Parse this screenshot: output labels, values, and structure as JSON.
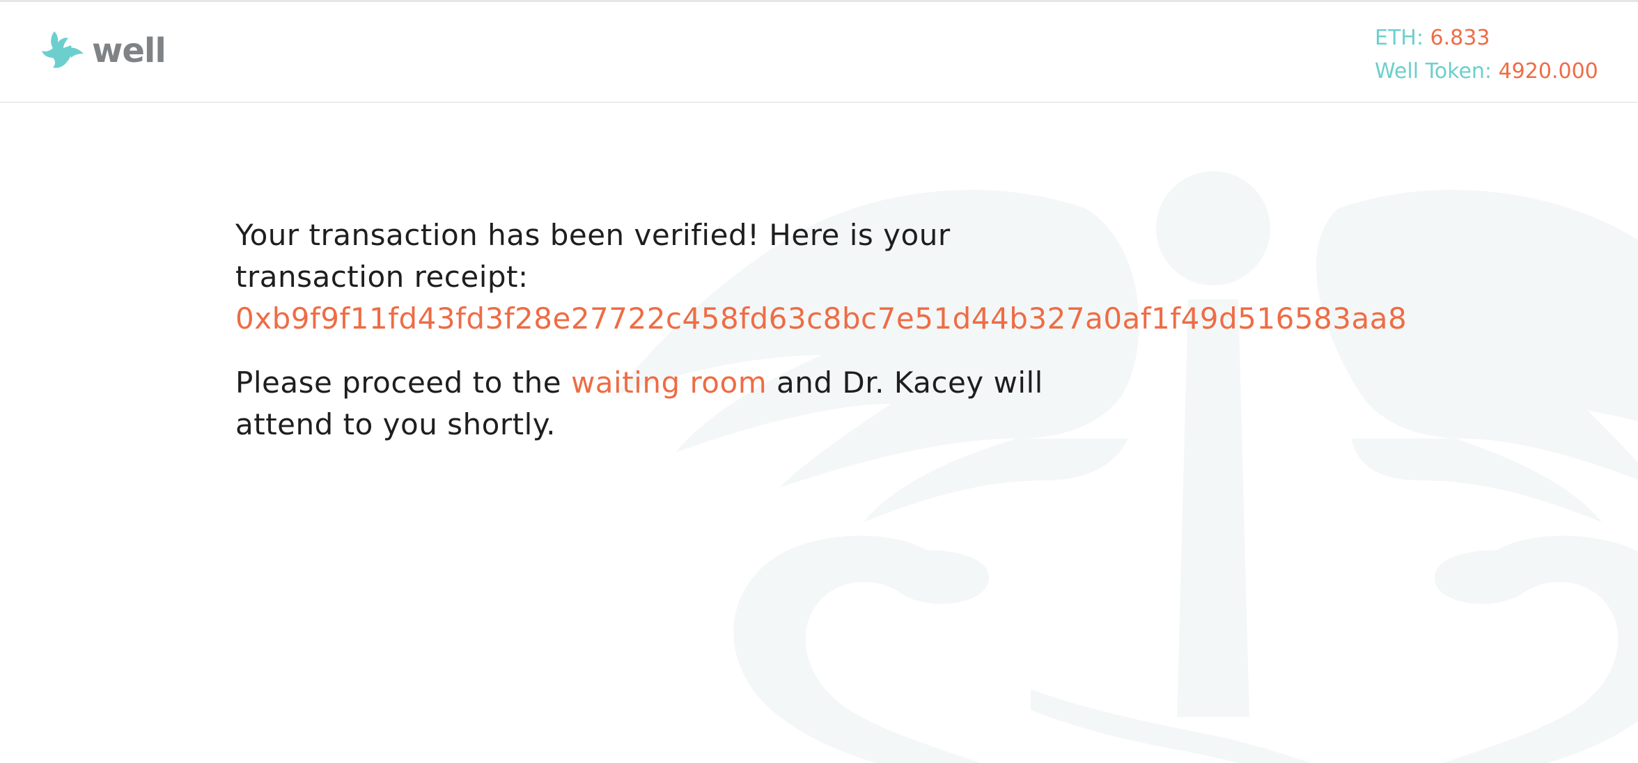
{
  "brand": {
    "name": "well",
    "accent": "#6ccfcd",
    "text_color": "#7f8386"
  },
  "balances": {
    "eth_label": "ETH:",
    "eth_value": "6.833",
    "token_label": "Well Token:",
    "token_value": "4920.000"
  },
  "message": {
    "verified_text": "Your transaction has been verified! Here is your transaction receipt:",
    "receipt_hash": "0xb9f9f11fd43fd3f28e27722c458fd63c8bc7e51d44b327a0af1f49d516583aa8",
    "proceed_before": "Please proceed to the",
    "waiting_room_link": "waiting room",
    "proceed_after": "and Dr. Kacey will attend to you shortly."
  },
  "colors": {
    "highlight": "#ee6c45",
    "watermark": "#f4f7f7"
  },
  "icons": {
    "logo": "dove-icon",
    "background": "caduceus-icon"
  }
}
